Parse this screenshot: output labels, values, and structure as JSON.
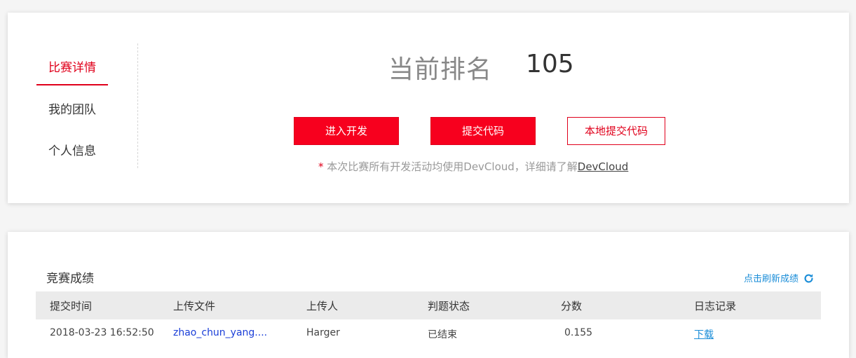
{
  "nav": {
    "items": [
      {
        "label": "比赛详情",
        "active": true
      },
      {
        "label": "我的团队",
        "active": false
      },
      {
        "label": "个人信息",
        "active": false
      }
    ]
  },
  "rank": {
    "label": "当前排名",
    "value": "105"
  },
  "actions": {
    "develop": "进入开发",
    "submit": "提交代码",
    "local_submit": "本地提交代码"
  },
  "note": {
    "star": "*",
    "text": " 本次比赛所有开发活动均使用DevCloud，详细请了解",
    "link": "DevCloud"
  },
  "results": {
    "title": "竞赛成绩",
    "refresh_label": "点击刷新成绩",
    "columns": [
      "提交时间",
      "上传文件",
      "上传人",
      "判题状态",
      "分数",
      "日志记录"
    ],
    "rows": [
      {
        "time": "2018-03-23 16:52:50",
        "file": "zhao_chun_yang....",
        "uploader": "Harger",
        "status": "已结束",
        "score": "0.155",
        "log": "下载"
      }
    ]
  },
  "colors": {
    "accent": "#e0001b",
    "link": "#1a8dd8"
  }
}
